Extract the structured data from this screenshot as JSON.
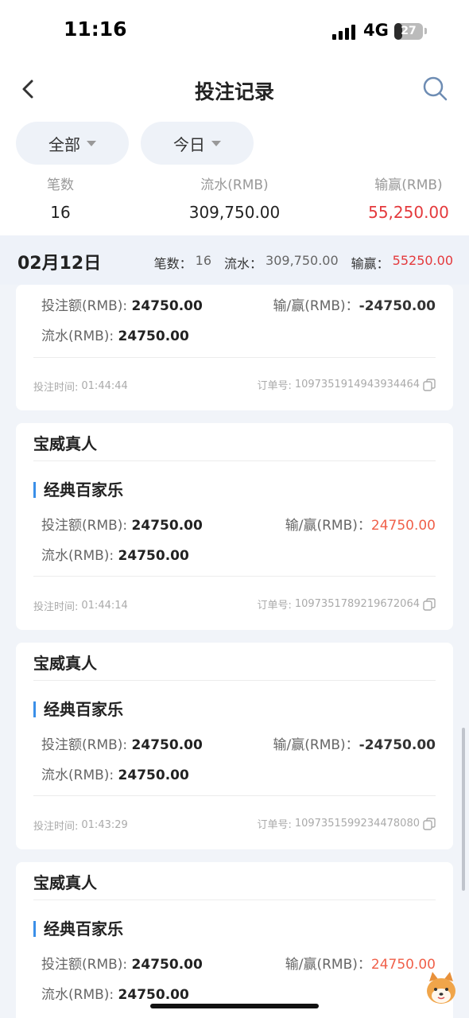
{
  "status": {
    "time": "11:16",
    "network": "4G",
    "battery": "27",
    "battery_level": 0.27
  },
  "nav": {
    "title": "投注记录",
    "back_icon": "chevron-left-icon",
    "search_icon": "search-icon"
  },
  "filters": [
    {
      "label": "全部"
    },
    {
      "label": "今日"
    }
  ],
  "summary": {
    "count_label": "笔数",
    "count_value": "16",
    "turnover_label": "流水(RMB)",
    "turnover_value": "309,750.00",
    "winloss_label": "输赢(RMB)",
    "winloss_value": "55,250.00"
  },
  "date_bar": {
    "date": "02月12日",
    "count_label": "笔数：",
    "count_value": "16",
    "turnover_label": "流水：",
    "turnover_value": "309,750.00",
    "winloss_label": "输赢：",
    "winloss_value": "55250.00"
  },
  "cards": [
    {
      "vendor": "",
      "game": "",
      "bet_label": "投注额(RMB):",
      "bet_value": "24750.00",
      "winloss_label": "输/赢(RMB)：",
      "winloss_value": "-24750.00",
      "turnover_label": "流水(RMB):",
      "turnover_value": "24750.00",
      "time_label": "投注时间:",
      "time_value": "01:44:44",
      "order_label": "订单号:",
      "order_value": "1097351914943934464"
    },
    {
      "vendor": "宝威真人",
      "game": "经典百家乐",
      "bet_label": "投注额(RMB):",
      "bet_value": "24750.00",
      "winloss_label": "输/赢(RMB)：",
      "winloss_value": "24750.00",
      "turnover_label": "流水(RMB):",
      "turnover_value": "24750.00",
      "time_label": "投注时间:",
      "time_value": "01:44:14",
      "order_label": "订单号:",
      "order_value": "1097351789219672064"
    },
    {
      "vendor": "宝威真人",
      "game": "经典百家乐",
      "bet_label": "投注额(RMB):",
      "bet_value": "24750.00",
      "winloss_label": "输/赢(RMB)：",
      "winloss_value": "-24750.00",
      "turnover_label": "流水(RMB):",
      "turnover_value": "24750.00",
      "time_label": "投注时间:",
      "time_value": "01:43:29",
      "order_label": "订单号:",
      "order_value": "1097351599234478080"
    },
    {
      "vendor": "宝威真人",
      "game": "经典百家乐",
      "bet_label": "投注额(RMB):",
      "bet_value": "24750.00",
      "winloss_label": "输/赢(RMB)：",
      "winloss_value": "24750.00",
      "turnover_label": "流水(RMB):",
      "turnover_value": "24750.00"
    }
  ],
  "colors": {
    "accent": "#3a8fe8",
    "win": "#f0604a",
    "summary_red": "#e4393c"
  },
  "icons": {
    "copy": "copy-icon",
    "mascot": "shiba-dog-icon"
  }
}
